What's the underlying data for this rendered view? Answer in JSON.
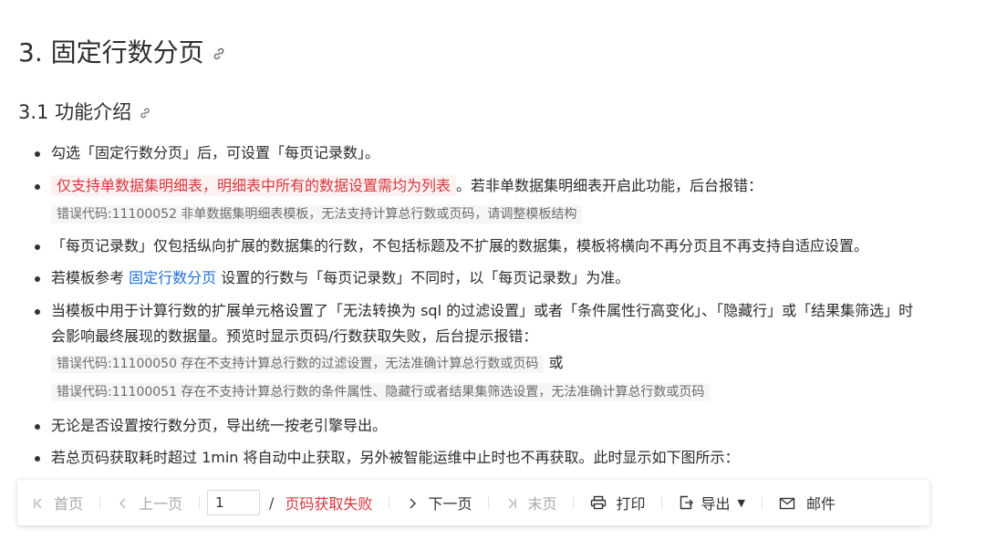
{
  "heading1": "3. 固定行数分页",
  "heading2": "3.1 功能介绍",
  "bullets": {
    "b1": "勾选「固定行数分页」后，可设置「每页记录数」。",
    "b2_highlight": "仅支持单数据集明细表，明细表中所有的数据设置需均为列表",
    "b2_rest": "。若非单数据集明细表开启此功能，后台报错：",
    "b2_code": "错误代码:11100052 非单数据集明细表模板，无法支持计算总行数或页码，请调整模板结构",
    "b3": "「每页记录数」仅包括纵向扩展的数据集的行数，不包括标题及不扩展的数据集，模板将横向不再分页且不再支持自适应设置。",
    "b4_pre": "若模板参考 ",
    "b4_link": "固定行数分页",
    "b4_post": " 设置的行数与「每页记录数」不同时，以「每页记录数」为准。",
    "b5_line1": "当模板中用于计算行数的扩展单元格设置了「无法转换为 sql 的过滤设置」或者「条件属性行高变化」、「隐藏行」或「结果集筛选」时",
    "b5_line2": "会影响最终展现的数据量。预览时显示页码/行数获取失败，后台提示报错：",
    "b5_code1": "错误代码:11100050 存在不支持计算总行数的过滤设置，无法准确计算总行数或页码",
    "b5_or": "或",
    "b5_code2": "错误代码:11100051 存在不支持计算总行数的条件属性、隐藏行或者结果集筛选设置，无法准确计算总行数或页码",
    "b6": "无论是否设置按行数分页，导出统一按老引擎导出。",
    "b7": "若总页码获取耗时超过 1min 将自动中止获取，另外被智能运维中止时也不再获取。此时显示如下图所示："
  },
  "pager": {
    "first": "首页",
    "prev": "上一页",
    "page_value": "1",
    "slash": "/",
    "fail_text": "页码获取失败",
    "next": "下一页",
    "last": "末页",
    "print": "打印",
    "export": "导出",
    "mail": "邮件"
  },
  "colors": {
    "link": "#1f6fd6",
    "error": "#d9363e",
    "code_bg": "#f6f6f6"
  }
}
